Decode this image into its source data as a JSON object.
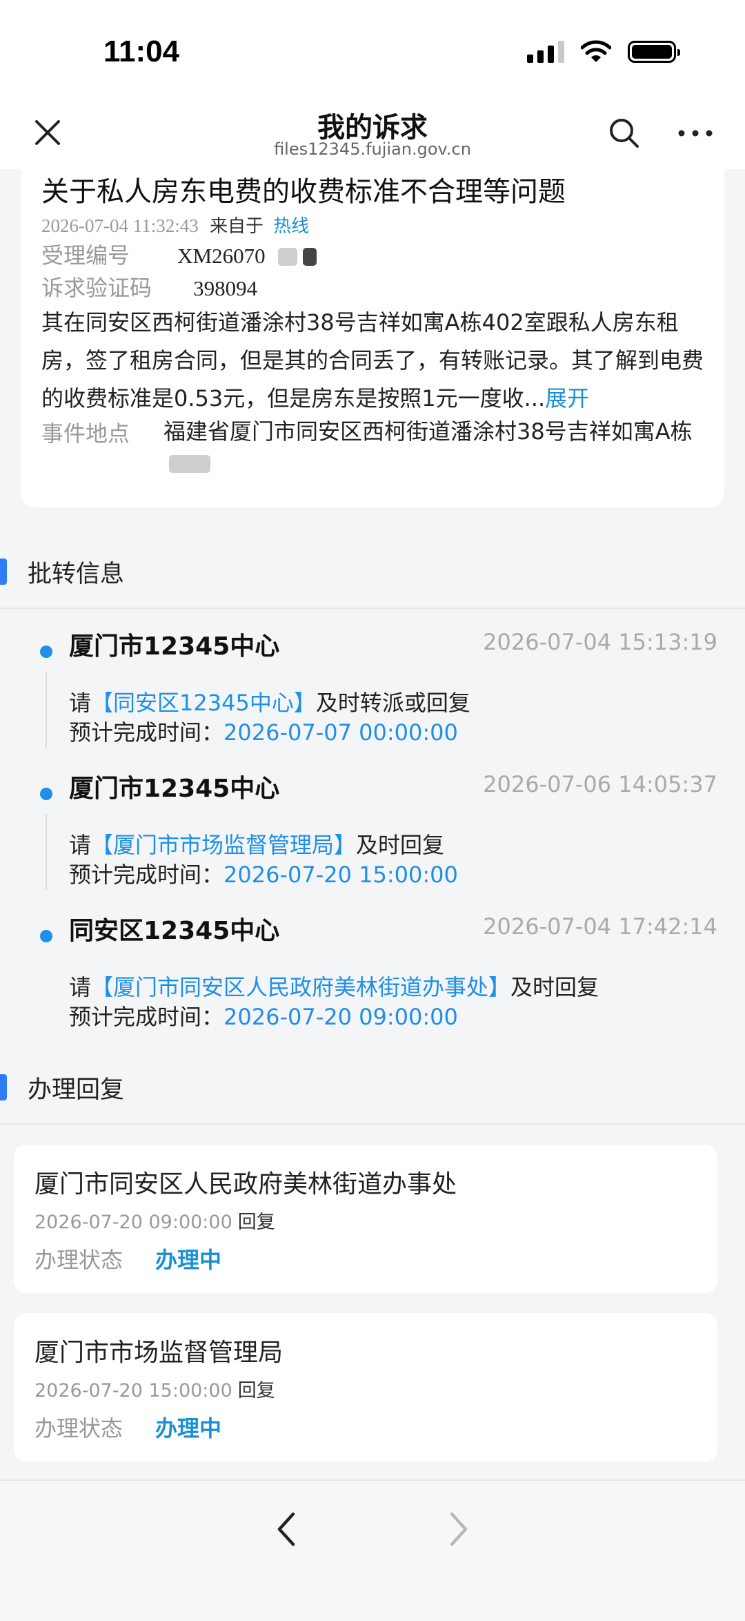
{
  "status_bar": {
    "time": "11:04"
  },
  "header": {
    "title": "我的诉求",
    "url": "files12345.fujian.gov.cn"
  },
  "complaint": {
    "title": "关于私人房东电费的收费标准不合理等问题",
    "datetime": "2026-07-04 11:32:43",
    "from_label": "来自于",
    "source": "热线",
    "case_no_label": "受理编号",
    "case_no_value": "XM26070",
    "verify_label": "诉求验证码",
    "verify_value": "398094",
    "content": "其在同安区西柯街道潘涂村38号吉祥如寓A栋402室跟私人房东租房，签了租房合同，但是其的合同丢了，有转账记录。其了解到电费的收费标准是0.53元，但是房东是按照1元一度收...",
    "expand_label": "展开",
    "location_label": "事件地点",
    "location_value": "福建省厦门市同安区西柯街道潘涂村38号吉祥如寓A栋"
  },
  "transfer_section": {
    "title": "批转信息",
    "items": [
      {
        "org": "厦门市12345中心",
        "time": "2026-07-04 15:13:19",
        "prefix": "请",
        "dept": "【同安区12345中心】",
        "action": "及时转派或回复",
        "deadline_label": "预计完成时间：",
        "deadline": "2026-07-07 00:00:00"
      },
      {
        "org": "厦门市12345中心",
        "time": "2026-07-06 14:05:37",
        "prefix": "请",
        "dept": "【厦门市市场监督管理局】",
        "action": "及时回复",
        "deadline_label": "预计完成时间：",
        "deadline": "2026-07-20 15:00:00"
      },
      {
        "org": "同安区12345中心",
        "time": "2026-07-04 17:42:14",
        "prefix": "请",
        "dept": "【厦门市同安区人民政府美林街道办事处】",
        "action": "及时回复",
        "deadline_label": "预计完成时间：",
        "deadline": "2026-07-20 09:00:00"
      }
    ]
  },
  "reply_section": {
    "title": "办理回复",
    "items": [
      {
        "org": "厦门市同安区人民政府美林街道办事处",
        "date": "2026-07-20 09:00:00",
        "reply_word": "回复",
        "status_label": "办理状态",
        "status_value": "办理中"
      },
      {
        "org": "厦门市市场监督管理局",
        "date": "2026-07-20 15:00:00",
        "reply_word": "回复",
        "status_label": "办理状态",
        "status_value": "办理中"
      }
    ]
  },
  "colors": {
    "accent_blue": "#1a8fd6",
    "section_bar": "#2f7df6",
    "background": "#f4f5f7"
  },
  "icons": [
    "close-icon",
    "search-icon",
    "more-icon",
    "back-arrow-icon",
    "forward-arrow-icon",
    "signal-icon",
    "wifi-icon",
    "battery-icon"
  ]
}
